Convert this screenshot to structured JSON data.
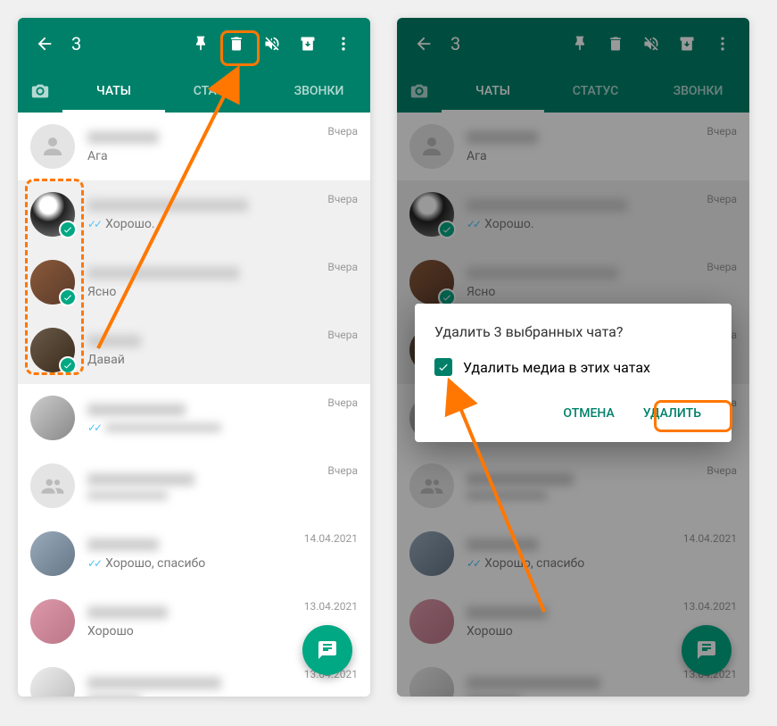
{
  "topbar": {
    "selected_count": "3"
  },
  "tabs": {
    "chats": "ЧАТЫ",
    "status": "СТАТУС",
    "calls": "ЗВОНКИ"
  },
  "chats": [
    {
      "msg": "Ага",
      "time": "Вчера",
      "ticks": false,
      "selected": false,
      "avatar": "gray"
    },
    {
      "msg": "Хорошо.",
      "time": "Вчера",
      "ticks": true,
      "selected": true,
      "avatar": "a1"
    },
    {
      "msg": "Ясно",
      "time": "Вчера",
      "ticks": false,
      "selected": true,
      "avatar": "a2"
    },
    {
      "msg": "Давай",
      "time": "Вчера",
      "ticks": false,
      "selected": true,
      "avatar": "a3"
    },
    {
      "msg": "",
      "time": "Вчера",
      "ticks": true,
      "selected": false,
      "avatar": "a4"
    },
    {
      "msg": "",
      "time": "Вчера",
      "ticks": false,
      "selected": false,
      "avatar": "group"
    },
    {
      "msg": "Хорошо, спасибо",
      "time": "14.04.2021",
      "ticks": true,
      "selected": false,
      "avatar": "a5"
    },
    {
      "msg": "Хорошо",
      "time": "13.04.2021",
      "ticks": false,
      "selected": false,
      "avatar": "a6"
    },
    {
      "msg": "",
      "time": "13.04.2021",
      "ticks": false,
      "selected": false,
      "avatar": "a7"
    }
  ],
  "dialog": {
    "title": "Удалить 3 выбранных чата?",
    "checkbox_label": "Удалить медиа в этих чатах",
    "cancel": "ОТМЕНА",
    "delete": "УДАЛИТЬ"
  }
}
